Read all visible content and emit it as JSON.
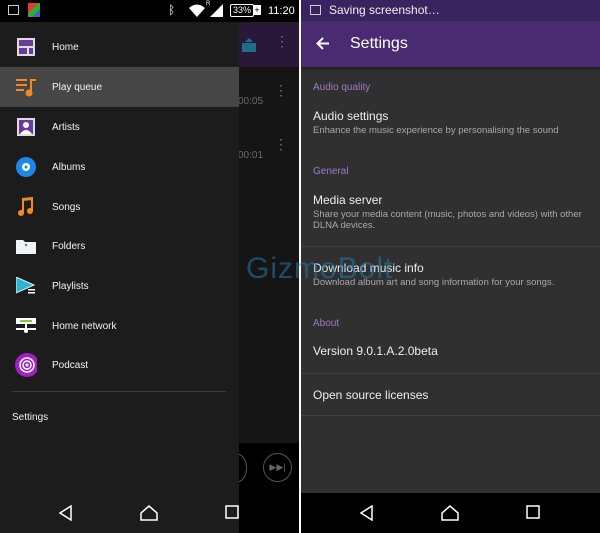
{
  "left_screen": {
    "status_bar": {
      "battery": "33%",
      "time": "11:20",
      "roaming": "R",
      "icons": [
        "image-icon",
        "app-icon",
        "bluetooth-icon",
        "wifi-icon",
        "signal-icon",
        "battery-icon"
      ]
    },
    "background": {
      "times": [
        "00:05",
        "00:01"
      ]
    },
    "drawer": {
      "items": [
        {
          "label": "Home",
          "icon": "home-grid-icon"
        },
        {
          "label": "Play queue",
          "icon": "play-queue-icon",
          "selected": true
        },
        {
          "label": "Artists",
          "icon": "artist-icon"
        },
        {
          "label": "Albums",
          "icon": "album-icon"
        },
        {
          "label": "Songs",
          "icon": "music-note-icon"
        },
        {
          "label": "Folders",
          "icon": "folder-icon"
        },
        {
          "label": "Playlists",
          "icon": "playlist-icon"
        },
        {
          "label": "Home network",
          "icon": "home-network-icon"
        },
        {
          "label": "Podcast",
          "icon": "podcast-icon"
        }
      ],
      "settings_label": "Settings"
    }
  },
  "right_screen": {
    "status_bar": {
      "text": "Saving screenshot…"
    },
    "toolbar": {
      "title": "Settings"
    },
    "sections": {
      "audio_quality": "Audio quality",
      "audio_settings": {
        "title": "Audio settings",
        "summary": "Enhance the music experience by personalising the sound"
      },
      "general": "General",
      "media_server": {
        "title": "Media server",
        "summary": "Share your media content (music, photos and videos) with other DLNA devices."
      },
      "download_info": {
        "title": "Download music info",
        "summary": "Download album art and song information for your songs."
      },
      "about": "About",
      "version": "Version 9.0.1.A.2.0beta",
      "licenses": "Open source licenses"
    }
  },
  "watermark": "GizmoBolt",
  "colors": {
    "accent": "#9a7cc4",
    "toolbar": "#4a2a70",
    "status_bar": "#3a2460"
  }
}
